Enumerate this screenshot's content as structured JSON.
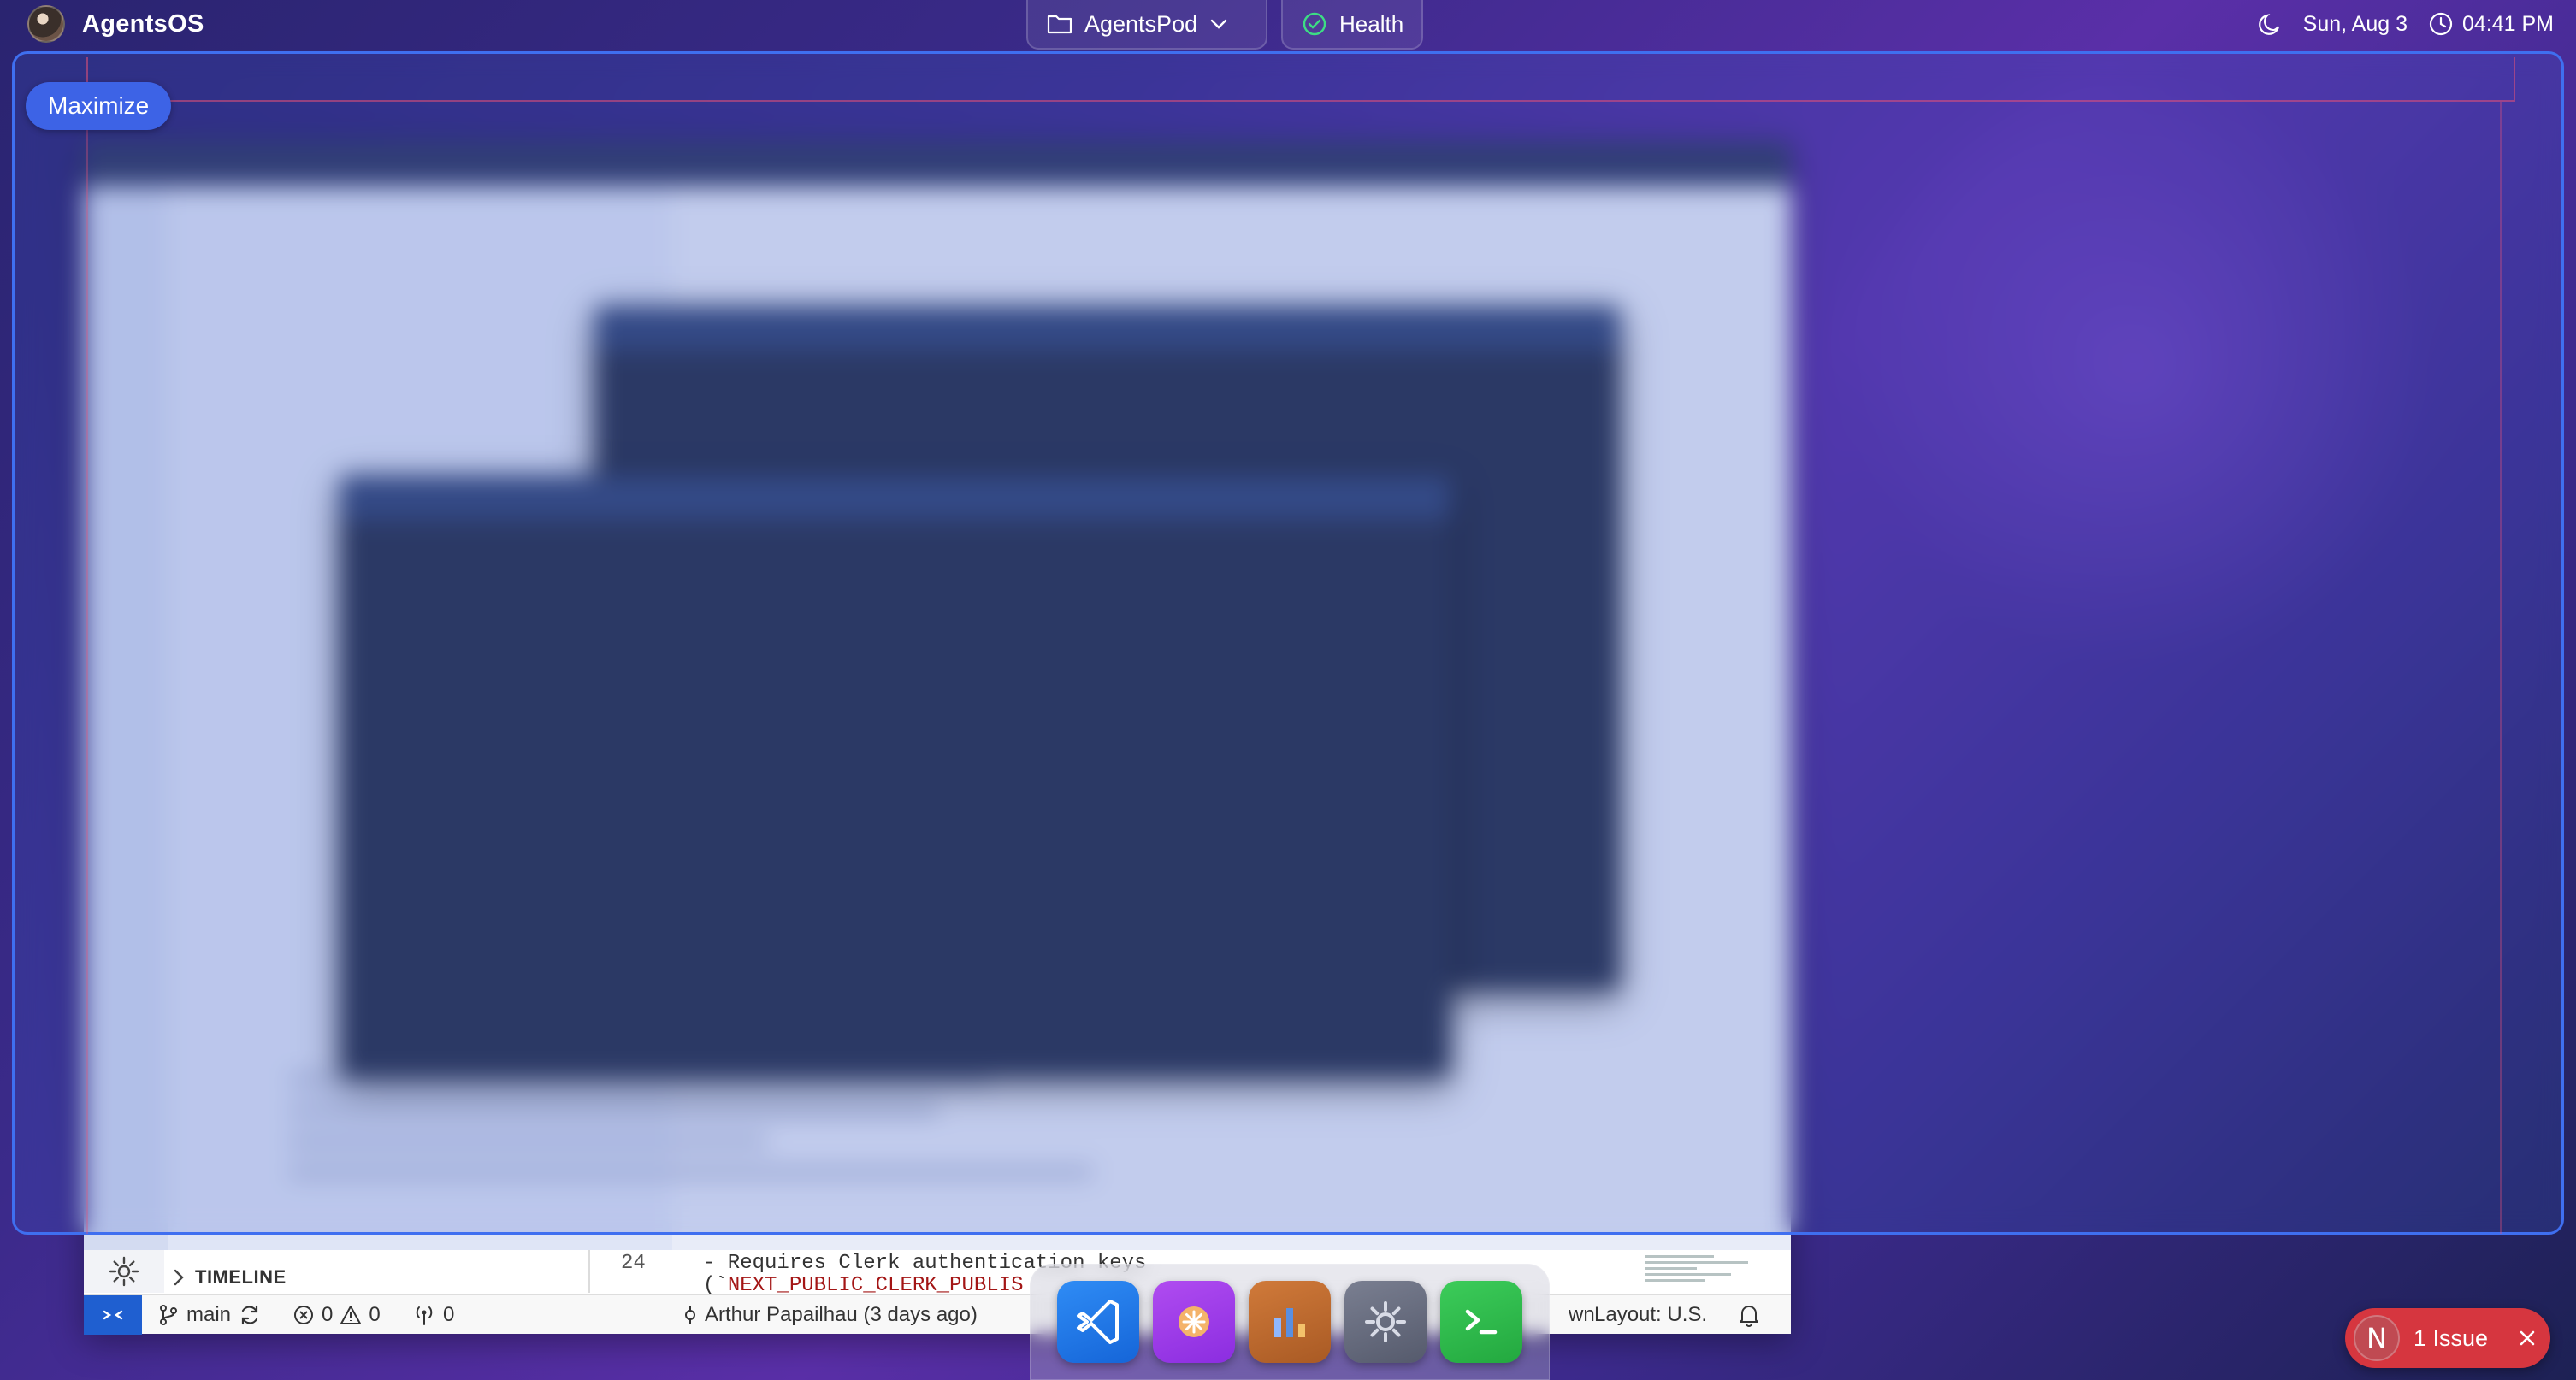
{
  "topbar": {
    "app_name": "AgentsOS",
    "project": "AgentsPod",
    "health": "Health",
    "date": "Sun, Aug 3",
    "time": "04:41 PM"
  },
  "overlay": {
    "maximize_label": "Maximize"
  },
  "vscode": {
    "panel_title": "TIMELINE",
    "line_number": "24",
    "code_line": "- Requires Clerk authentication keys",
    "code_line2_prefix": "(`",
    "code_line2_highlight": "NEXT_PUBLIC_CLERK_PUBLIS",
    "status": {
      "branch": "main",
      "errors": "0",
      "warnings": "0",
      "ports": "0",
      "blame": "Arthur Papailhau (3 days ago)",
      "language_fragment": "wn",
      "layout": "Layout: U.S."
    }
  },
  "dock": {
    "apps": [
      "vscode-app",
      "claude-app",
      "charts-app",
      "settings-app",
      "terminal-app"
    ]
  },
  "toast": {
    "badge": "N",
    "label": "1 Issue"
  },
  "colors": {
    "accent": "#3d63e6",
    "error": "#d6363f",
    "statusbar_remote": "#1f5fd0"
  }
}
